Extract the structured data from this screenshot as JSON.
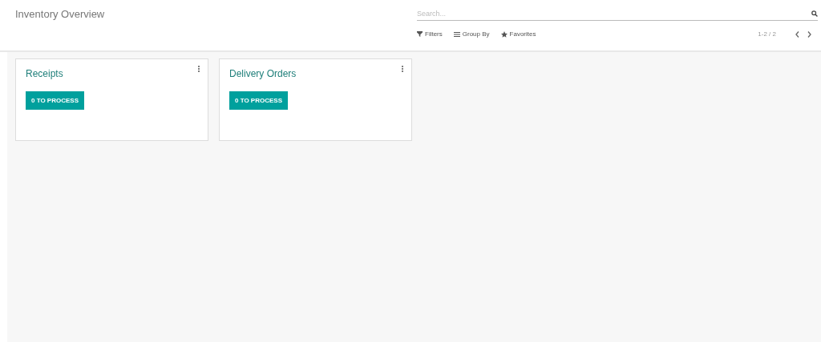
{
  "title": "Inventory Overview",
  "search": {
    "placeholder": "Search..."
  },
  "filters": [
    {
      "label": "Filters",
      "kind": "filter"
    },
    {
      "label": "Group By",
      "kind": "group"
    },
    {
      "label": "Favorites",
      "kind": "favorite"
    }
  ],
  "pager": "1-2 / 2",
  "cards": [
    {
      "title": "Receipts",
      "action": "0 TO PROCESS"
    },
    {
      "title": "Delivery Orders",
      "action": "0 TO PROCESS"
    }
  ]
}
